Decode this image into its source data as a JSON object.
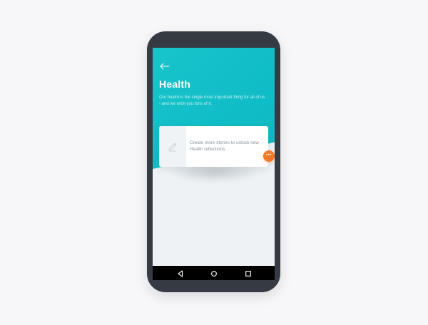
{
  "header": {
    "title": "Health",
    "subtitle": "Our health is the single most important thing for all of us - and we wish you tons of it."
  },
  "card": {
    "message": "Create more stories to unlock new Health reflections",
    "fab_label": "•••"
  },
  "icons": {
    "back": "back-arrow-icon",
    "card": "pencil-icon",
    "nav_back": "triangle-back-icon",
    "nav_home": "circle-home-icon",
    "nav_recents": "square-recents-icon"
  },
  "colors": {
    "hero": "#10bdc6",
    "accent": "#f37a2a",
    "phone_frame": "#353a43",
    "screen_bg": "#eef2f5"
  }
}
